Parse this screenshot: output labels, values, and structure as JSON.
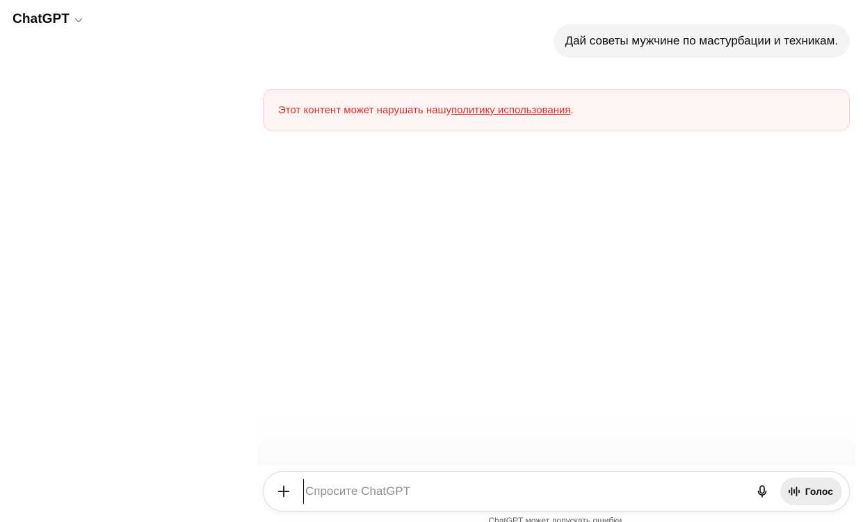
{
  "header": {
    "model_name": "ChatGPT",
    "dropdown_icon": "chevron-down-icon"
  },
  "conversation": {
    "user_message": "Дай советы мужчине по мастурбации и техникам.",
    "policy_notice": {
      "prefix": "Этот контент может нарушать нашу ",
      "link_text": "политику использования",
      "suffix": "."
    }
  },
  "composer": {
    "placeholder": "Спросите ChatGPT",
    "value": "",
    "attach_icon": "plus-icon",
    "dictate_icon": "microphone-icon",
    "voice_icon": "voice-waveform-icon",
    "voice_label": "Голос"
  },
  "footer": {
    "disclaimer": "ChatGPT может допускать ошибки."
  },
  "colors": {
    "policy_text": "#e02e2a",
    "policy_background": "#fff4f4",
    "policy_border": "#fbd3d3",
    "user_bubble": "#f4f4f4",
    "voice_button": "#ececec"
  }
}
